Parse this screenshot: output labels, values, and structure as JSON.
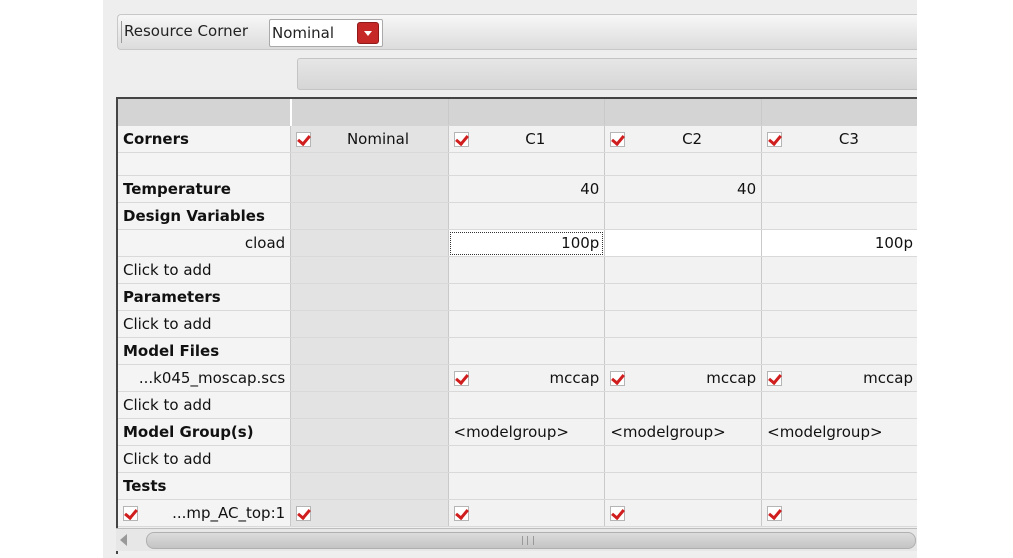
{
  "toolbar": {
    "resource_corner_label": "Resource Corner",
    "resource_corner_value": "Nominal"
  },
  "columns": [
    {
      "name": "Nominal",
      "checked": true
    },
    {
      "name": "C1",
      "checked": true
    },
    {
      "name": "C2",
      "checked": true
    },
    {
      "name": "C3",
      "checked": true
    }
  ],
  "rows": {
    "corners_label": "Corners",
    "temperature": {
      "label": "Temperature",
      "values": [
        "",
        "40",
        "40",
        ""
      ]
    },
    "design_variables": {
      "label": "Design Variables"
    },
    "cload": {
      "label": "cload",
      "values": [
        "",
        "100p",
        "",
        "100p"
      ]
    },
    "click_to_add": "Click to add",
    "parameters": {
      "label": "Parameters"
    },
    "model_files": {
      "label": "Model Files"
    },
    "model_file_row": {
      "label": "...k045_moscap.scs",
      "values": [
        "",
        "mccap",
        "mccap",
        "mccap"
      ]
    },
    "model_groups": {
      "label": "Model Group(s)",
      "placeholder": "<modelgroup>"
    },
    "tests": {
      "label": "Tests"
    },
    "test_row": {
      "label": "...mp_AC_top:1"
    }
  },
  "colors": {
    "accent": "#c62828",
    "check": "#d01e1e"
  }
}
